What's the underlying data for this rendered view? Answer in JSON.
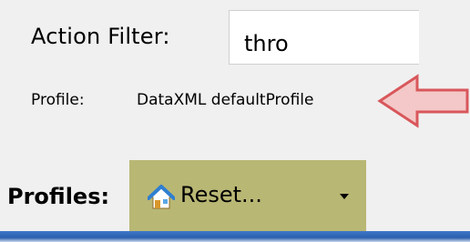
{
  "filter": {
    "label": "Action Filter:",
    "value": "thro"
  },
  "profile": {
    "label": "Profile:",
    "value": "DataXML defaultProfile"
  },
  "toolbar": {
    "profiles_label": "Profiles:",
    "dropdown_value": "Reset...",
    "dropdown_icon": "home-icon",
    "dropdown_bg": "#b9b774"
  },
  "annotation": {
    "arrow_fill": "#f4c8c8",
    "arrow_stroke": "#d8575b"
  }
}
